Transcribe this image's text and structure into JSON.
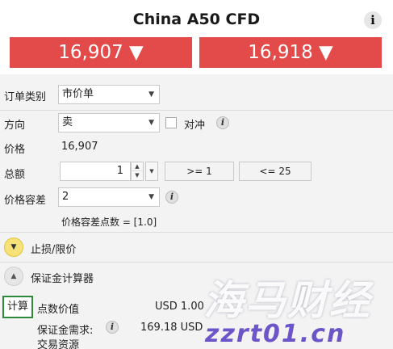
{
  "header": {
    "title": "China A50 CFD",
    "info_label": "i",
    "sell_price": "16,907",
    "buy_price": "16,918",
    "arrow": "▼"
  },
  "order": {
    "type_label": "订单类别",
    "type_value": "市价单",
    "direction_label": "方向",
    "direction_value": "卖",
    "hedge_label": "对冲",
    "price_label": "价格",
    "price_value": "16,907",
    "amount_label": "总额",
    "amount_value": "1",
    "min_limit": ">= 1",
    "max_limit": "<= 25",
    "tolerance_label": "价格容差",
    "tolerance_value": "2",
    "tolerance_points": "价格容差点数 = [1.0]"
  },
  "sections": {
    "stop_limit": "止损/限价",
    "margin_calc": "保证金计算器"
  },
  "calculator": {
    "button_label": "计算",
    "point_value_label": "点数价值",
    "point_value": "USD 1.00",
    "margin_label": "保证金需求:",
    "margin_value": "169.18 USD",
    "trading_resources": "交易资源"
  },
  "watermark": {
    "chinese": "海马财经",
    "domain": "zzrt01.cn"
  },
  "icons": {
    "dropdown": "▼",
    "spin_up": "▲",
    "spin_down": "▼",
    "info": "i"
  },
  "colors": {
    "price_red": "#e24b4a",
    "calc_green": "#2d8a3d",
    "expand_yellow": "#f7e27a",
    "watermark_purple": "#6b55c9"
  }
}
